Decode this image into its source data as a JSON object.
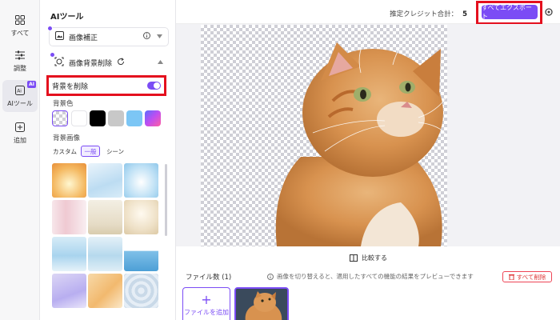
{
  "rail": {
    "items": [
      {
        "label": "すべて",
        "icon": "grid-icon"
      },
      {
        "label": "調整",
        "icon": "sliders-icon"
      },
      {
        "label": "AIツール",
        "icon": "ai-tool-icon",
        "badge": "AI",
        "active": true
      },
      {
        "label": "追加",
        "icon": "plus-square-icon"
      }
    ]
  },
  "panel": {
    "title": "AIツール",
    "enhance": {
      "label": "画像補正"
    },
    "bg_removal": {
      "label": "画像背景削除"
    },
    "remove_bg_toggle": {
      "label": "背景を削除",
      "on": true
    },
    "bg_color_label": "背景色",
    "bg_colors": [
      "transparent",
      "#ffffff",
      "#000000",
      "#c8c8c8",
      "#7cc6f5",
      "gradient"
    ],
    "bg_image_label": "背景画像",
    "tabs": [
      "カスタム",
      "一般",
      "シーン"
    ],
    "active_tab": "一般"
  },
  "topbar": {
    "credit_label": "推定クレジット合計：",
    "credit_value": "5",
    "export_label": "すべてエクスポート"
  },
  "compare_label": "比較する",
  "files": {
    "count_label": "ファイル数 (1)",
    "hint": "画像を切り替えると、適用したすべての機能の結果をプレビューできます",
    "delete_all": "すべて削除",
    "add_file": "ファイルを追加"
  },
  "colors": {
    "accent": "#7b4cf5",
    "highlight": "#e4101e"
  }
}
